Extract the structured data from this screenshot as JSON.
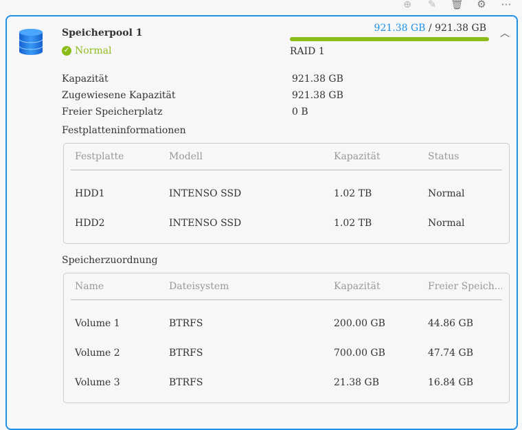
{
  "toolbar": {
    "add": "⊕",
    "edit": "✎",
    "delete": "🗑",
    "settings": "⚙",
    "more": "⋯"
  },
  "pool": {
    "name": "Speicherpool 1",
    "status": "Normal",
    "used": "921.38 GB",
    "sep": " / ",
    "total": "921.38 GB",
    "raid": "RAID 1",
    "usage_fraction": 1.0
  },
  "details": [
    {
      "label": "Kapazität",
      "value": "921.38 GB"
    },
    {
      "label": "Zugewiesene Kapazität",
      "value": "921.38 GB"
    },
    {
      "label": "Freier Speicherplatz",
      "value": "0 B"
    }
  ],
  "disks": {
    "title": "Festplatteninformationen",
    "headers": [
      "Festplatte",
      "Modell",
      "Kapazität",
      "Status"
    ],
    "rows": [
      [
        "HDD1",
        "INTENSO SSD",
        "1.02 TB",
        "Normal"
      ],
      [
        "HDD2",
        "INTENSO SSD",
        "1.02 TB",
        "Normal"
      ]
    ]
  },
  "volumes": {
    "title": "Speicherzuordnung",
    "headers": [
      "Name",
      "Dateisystem",
      "Kapazität",
      "Freier Speich..."
    ],
    "rows": [
      [
        "Volume 1",
        "BTRFS",
        "200.00 GB",
        "44.86 GB"
      ],
      [
        "Volume 2",
        "BTRFS",
        "700.00 GB",
        "47.74 GB"
      ],
      [
        "Volume 3",
        "BTRFS",
        "21.38 GB",
        "16.84 GB"
      ]
    ]
  }
}
